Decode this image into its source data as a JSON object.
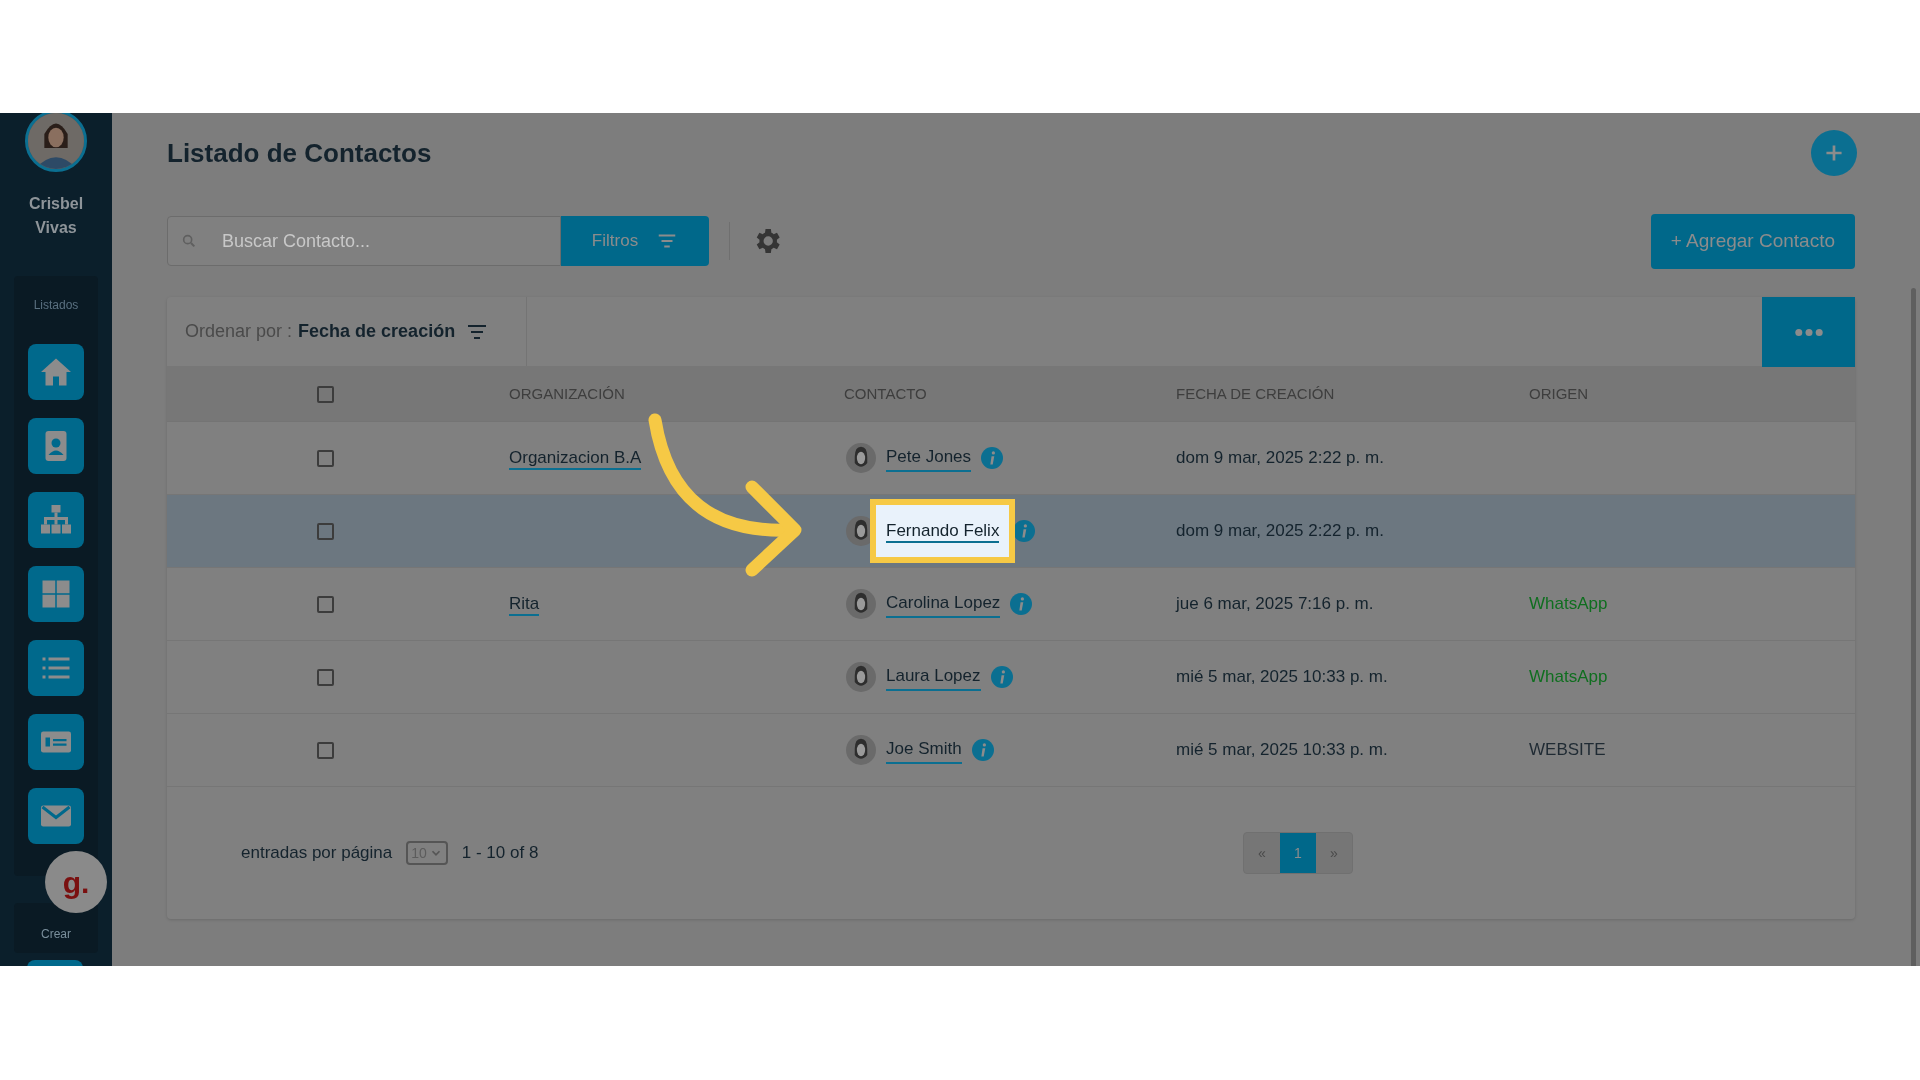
{
  "sidebar": {
    "user_name": "Crisbel Vivas",
    "section_label": "Listados",
    "create_label": "Crear",
    "badge": "g."
  },
  "header": {
    "title": "Listado de Contactos",
    "search_placeholder": "Buscar Contacto...",
    "filter_button": "Filtros",
    "add_button": "+ Agregar Contacto"
  },
  "sort": {
    "label": "Ordenar por :",
    "value": "Fecha de creación"
  },
  "table": {
    "columns": [
      "ORGANIZACIÓN",
      "CONTACTO",
      "FECHA DE CREACIÓN",
      "ORIGEN"
    ],
    "all_checked": false,
    "rows": [
      {
        "organization": "Organizacion B.A",
        "contact": "Pete Jones",
        "created": "dom 9 mar, 2025 2:22 p. m.",
        "origin": "",
        "checked": false,
        "selected": false,
        "spotlight": false
      },
      {
        "organization": "",
        "contact": "Fernando Felix",
        "created": "dom 9 mar, 2025 2:22 p. m.",
        "origin": "",
        "checked": false,
        "selected": true,
        "spotlight": true
      },
      {
        "organization": "Rita",
        "contact": "Carolina Lopez",
        "created": "jue 6 mar, 2025 7:16 p. m.",
        "origin": "WhatsApp",
        "color": "#0f6e1f",
        "checked": false,
        "selected": false,
        "spotlight": false
      },
      {
        "organization": "",
        "contact": "Laura Lopez",
        "created": "mié 5 mar, 2025 10:33 p. m.",
        "origin": "WhatsApp",
        "color": "#0f6e1f",
        "checked": false,
        "selected": false,
        "spotlight": false
      },
      {
        "organization": "",
        "contact": "Joe Smith",
        "created": "mié 5 mar, 2025 10:33 p. m.",
        "origin": "WEBSITE",
        "color": "#1f2a33",
        "checked": false,
        "selected": false,
        "spotlight": false
      }
    ]
  },
  "footer": {
    "per_page_label": "entradas por página",
    "per_page": "10",
    "range": "1 - 10 of 8",
    "pages": [
      {
        "label": "«",
        "selected": false
      },
      {
        "label": "1",
        "selected": true
      },
      {
        "label": "»",
        "selected": false
      }
    ]
  }
}
